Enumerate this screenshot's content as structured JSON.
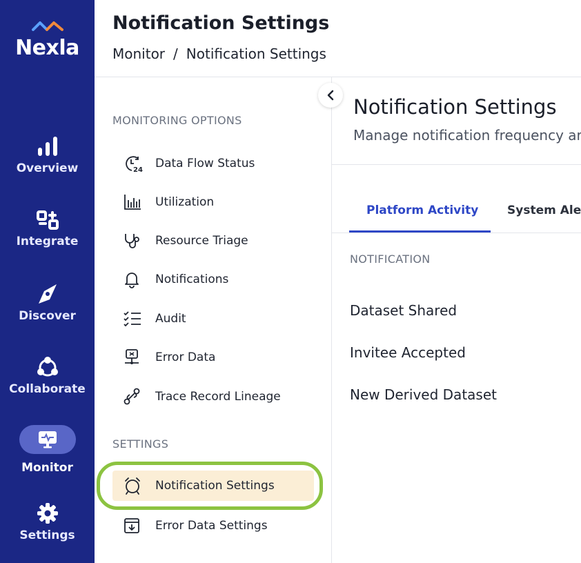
{
  "brand": {
    "name": "Nexla",
    "accent": "#5aa0ff",
    "accent2": "#f08a3c"
  },
  "rail": {
    "items": [
      {
        "label": "Overview",
        "icon": "bar-chart-icon"
      },
      {
        "label": "Integrate",
        "icon": "integrate-icon"
      },
      {
        "label": "Discover",
        "icon": "compass-icon"
      },
      {
        "label": "Collaborate",
        "icon": "collaborate-icon"
      },
      {
        "label": "Monitor",
        "icon": "monitor-icon",
        "active": true
      },
      {
        "label": "Settings",
        "icon": "gear-icon"
      }
    ]
  },
  "header": {
    "title": "Notification Settings",
    "breadcrumb": [
      "Monitor",
      "Notification Settings"
    ],
    "separator": "/"
  },
  "subnav": {
    "monitoring_title": "MONITORING OPTIONS",
    "monitoring_items": [
      {
        "label": "Data Flow Status",
        "icon": "clock-24-icon"
      },
      {
        "label": "Utilization",
        "icon": "utilization-chart-icon"
      },
      {
        "label": "Resource Triage",
        "icon": "stethoscope-icon"
      },
      {
        "label": "Notifications",
        "icon": "bell-icon"
      },
      {
        "label": "Audit",
        "icon": "checklist-icon"
      },
      {
        "label": "Error Data",
        "icon": "network-error-icon"
      },
      {
        "label": "Trace Record Lineage",
        "icon": "trace-lineage-icon"
      }
    ],
    "settings_title": "SETTINGS",
    "settings_items": [
      {
        "label": "Notification Settings",
        "icon": "alarm-icon",
        "selected": true
      },
      {
        "label": "Error Data Settings",
        "icon": "download-box-icon"
      }
    ]
  },
  "content": {
    "title": "Notification Settings",
    "subtitle": "Manage notification frequency ar",
    "tabs": [
      {
        "label": "Platform Activity",
        "active": true
      },
      {
        "label": "System Aler"
      }
    ],
    "column_header": "NOTIFICATION",
    "rows": [
      "Dataset Shared",
      "Invitee Accepted",
      "New Derived Dataset"
    ]
  }
}
